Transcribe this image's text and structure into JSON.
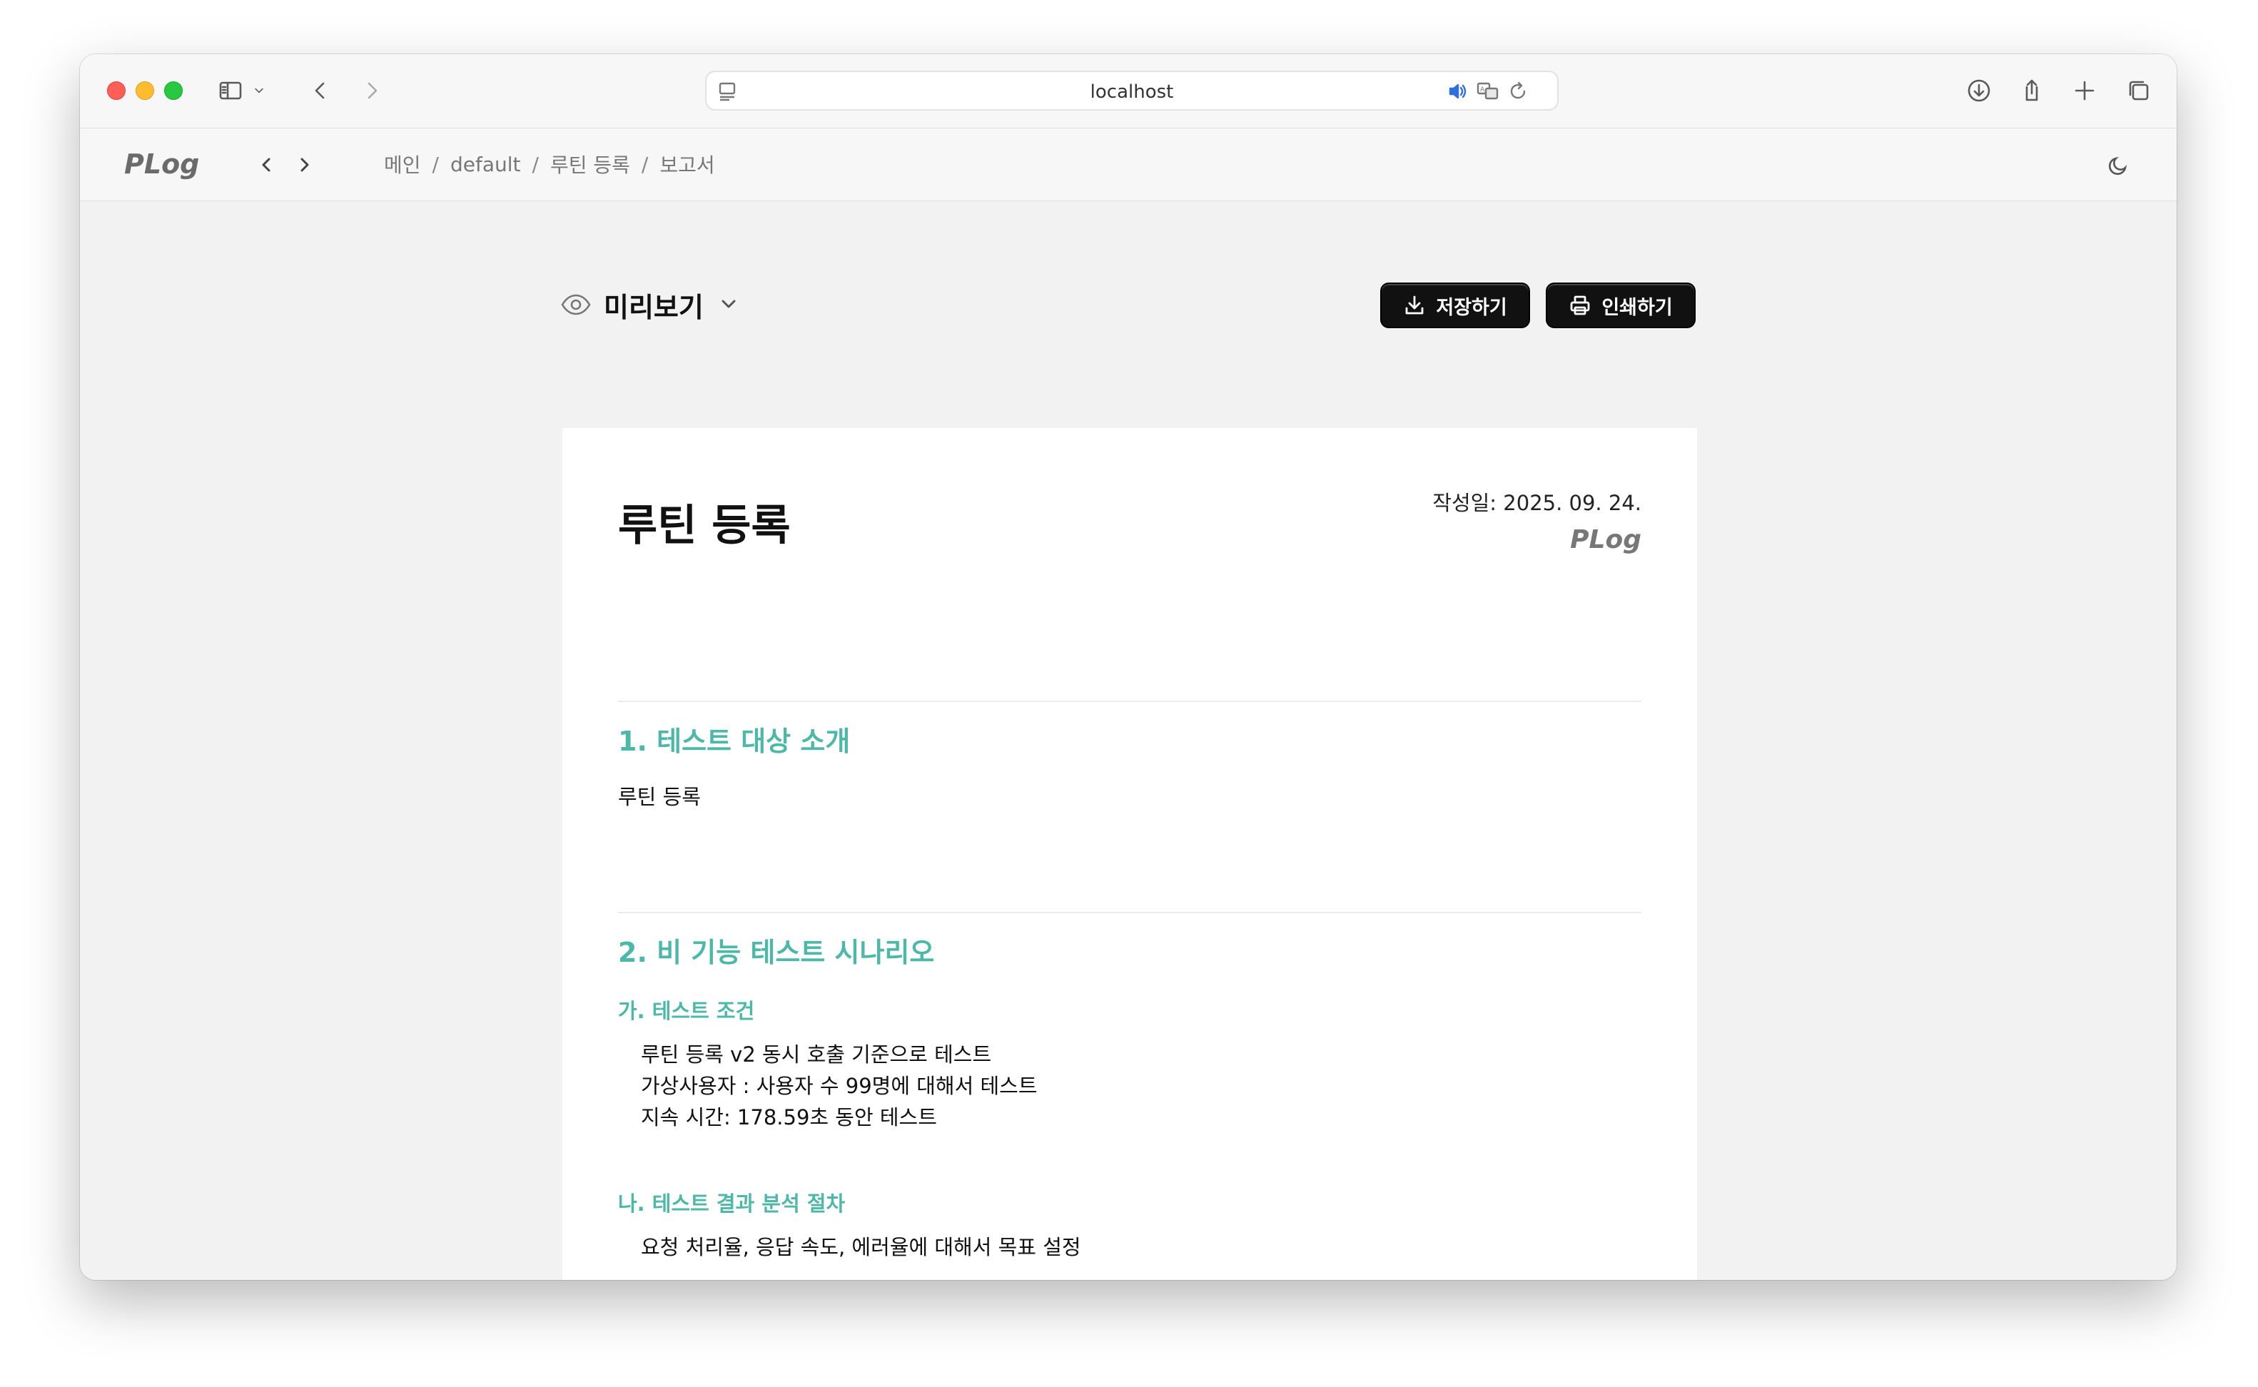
{
  "browser": {
    "url": "localhost"
  },
  "app": {
    "logo": "PLog",
    "breadcrumb": [
      "메인",
      "default",
      "루틴 등록",
      "보고서"
    ],
    "breadcrumb_separator": "/"
  },
  "toolbar": {
    "preview_label": "미리보기",
    "save_label": "저장하기",
    "print_label": "인쇄하기"
  },
  "document": {
    "title": "루틴 등록",
    "date": "작성일: 2025. 09. 24.",
    "brand": "PLog",
    "section1": {
      "title": "1. 테스트 대상 소개",
      "body": "루틴 등록"
    },
    "section2": {
      "title": "2. 비 기능 테스트 시나리오",
      "sub_a": {
        "title": "가. 테스트 조건",
        "items": [
          "루틴 등록 v2 동시 호출 기준으로 테스트",
          "가상사용자 : 사용자 수 99명에 대해서 테스트",
          "지속 시간: 178.59초 동안 테스트"
        ]
      },
      "sub_b": {
        "title": "나. 테스트 결과 분석 절차",
        "items": [
          "요청 처리율, 응답 속도, 에러율에 대해서 목표 설정"
        ]
      }
    }
  },
  "colors": {
    "accent": "#4cb8a8",
    "button_bg": "#111111"
  }
}
